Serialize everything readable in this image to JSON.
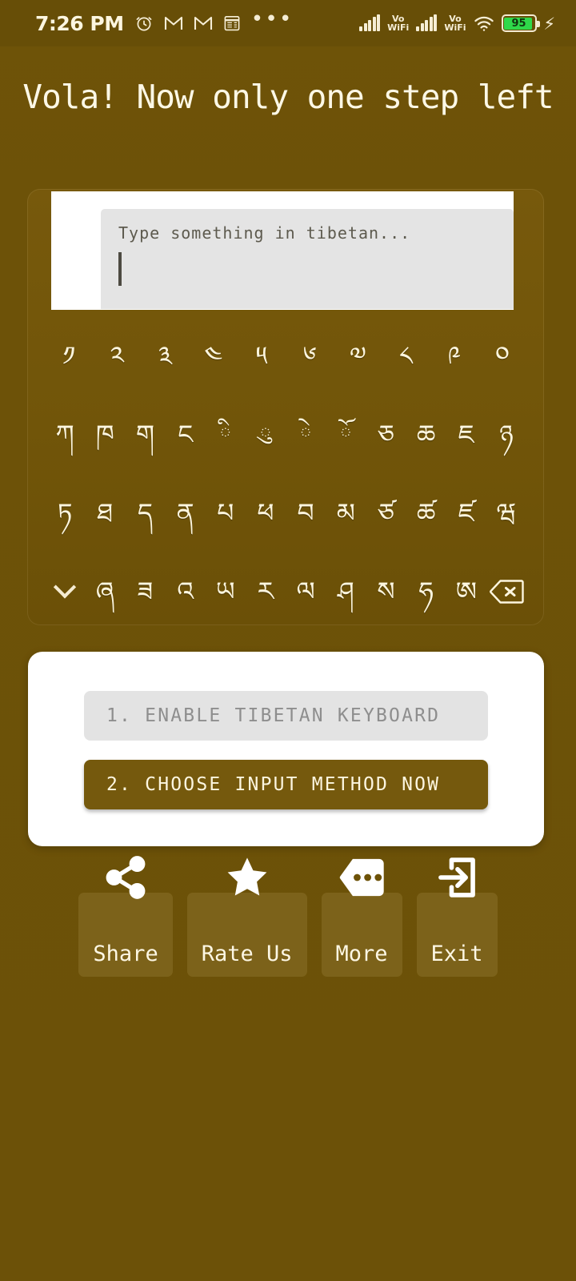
{
  "status_bar": {
    "time": "7:26 PM",
    "left_icons": [
      "alarm-clock-icon",
      "gmail-icon",
      "gmail-icon",
      "news-icon",
      "more-notifications-icon"
    ],
    "overflow_dots": "•••",
    "sim1_label": "Vo\nWiFi",
    "sim1_line1": "Vo",
    "sim1_line2": "WiFi",
    "sim2_line1": "Vo",
    "sim2_line2": "WiFi",
    "battery_percent": "95",
    "charging": true,
    "battery_color": "#2fd84a"
  },
  "title": "Vola! Now only one step left",
  "keyboard_preview": {
    "input_placeholder": "Type something in tibetan...",
    "input_value": "",
    "rows": [
      {
        "keys": [
          "༡",
          "༢",
          "༣",
          "༤",
          "༥",
          "༦",
          "༧",
          "༨",
          "༩",
          "༠"
        ],
        "names": [
          "key-tibetan-digit-1",
          "key-tibetan-digit-2",
          "key-tibetan-digit-3",
          "key-tibetan-digit-4",
          "key-tibetan-digit-5",
          "key-tibetan-digit-6",
          "key-tibetan-digit-7",
          "key-tibetan-digit-8",
          "key-tibetan-digit-9",
          "key-tibetan-digit-0"
        ]
      },
      {
        "keys": [
          "ཀ",
          "ཁ",
          "ག",
          "ང",
          "ི",
          "ུ",
          "ེ",
          "ོ",
          "ཅ",
          "ཆ",
          "ཇ",
          "ཉ"
        ],
        "names": [
          "key-ka",
          "key-kha",
          "key-ga",
          "key-nga",
          "key-vowel-i",
          "key-vowel-u",
          "key-vowel-e",
          "key-vowel-o",
          "key-ca",
          "key-cha",
          "key-ja",
          "key-nya"
        ]
      },
      {
        "keys": [
          "ཏ",
          "ཐ",
          "ད",
          "ན",
          "པ",
          "ཕ",
          "བ",
          "མ",
          "ཙ",
          "ཚ",
          "ཛ",
          "ཝ"
        ],
        "names": [
          "key-ta",
          "key-tha",
          "key-da",
          "key-na",
          "key-pa",
          "key-pha",
          "key-ba",
          "key-ma",
          "key-tsa",
          "key-tsha",
          "key-dza",
          "key-wa"
        ]
      },
      {
        "keys": [
          "ཞ",
          "ཟ",
          "འ",
          "ཡ",
          "ར",
          "ལ",
          "ཤ",
          "ས",
          "ཧ",
          "ཨ"
        ],
        "names": [
          "key-zha",
          "key-za",
          "key-a-chung",
          "key-ya",
          "key-ra",
          "key-la",
          "key-sha",
          "key-sa",
          "key-ha",
          "key-a"
        ],
        "leading_icon": "chevron-down-icon",
        "trailing_icon": "backspace-icon"
      }
    ]
  },
  "action_card": {
    "step1_label": "1. ENABLE TIBETAN KEYBOARD",
    "step1_enabled": false,
    "step2_label": "2. CHOOSE INPUT METHOD NOW",
    "step2_enabled": true
  },
  "bottom_bar": {
    "buttons": [
      {
        "label": "Share",
        "icon": "share-nodes-icon"
      },
      {
        "label": "Rate Us",
        "icon": "star-icon"
      },
      {
        "label": "More",
        "icon": "tag-ellipsis-icon"
      },
      {
        "label": "Exit",
        "icon": "exit-arrow-icon"
      }
    ]
  },
  "colors": {
    "background": "#6d5208",
    "card_white": "#ffffff",
    "accent_brown": "#75590d",
    "text_cream": "#fdf6e0",
    "disabled_grey": "#e3e3e3",
    "disabled_text": "#8e8e8e"
  }
}
